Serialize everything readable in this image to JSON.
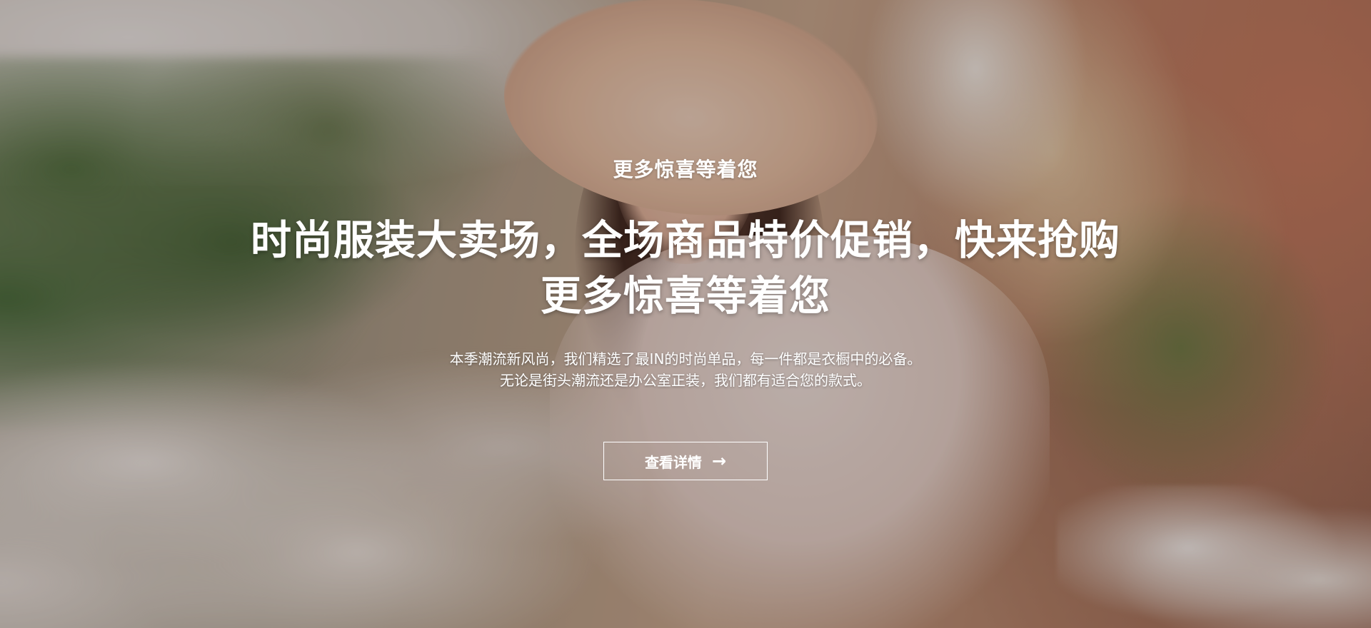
{
  "hero": {
    "subtitle": "更多惊喜等着您",
    "headline_line1": "时尚服装大卖场，全场商品特价促销，快来抢购",
    "headline_line2": "更多惊喜等着您",
    "description_line1": "本季潮流新风尚，我们精选了最IN的时尚单品，每一件都是衣橱中的必备。",
    "description_line2": "无论是街头潮流还是办公室正装，我们都有适合您的款式。",
    "cta_label": "查看详情",
    "cta_icon": "arrow-right-icon",
    "cta_arrow": "→"
  },
  "colors": {
    "text": "#ffffff",
    "button_border": "#ffffff"
  }
}
